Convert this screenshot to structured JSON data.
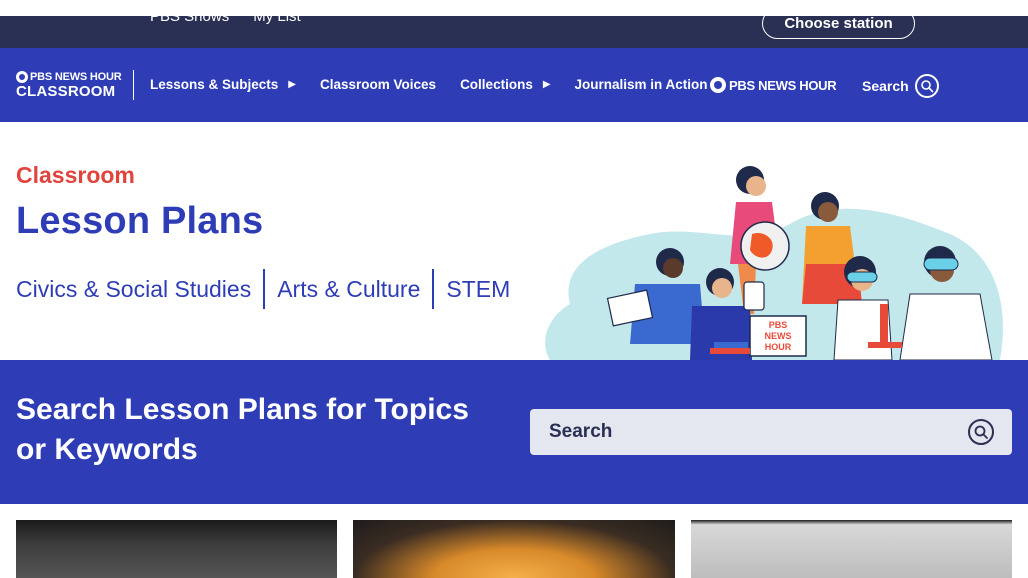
{
  "utility": {
    "links": [
      "PBS Shows",
      "My List"
    ],
    "station_button": "Choose station"
  },
  "nav": {
    "logo_line1": "PBS NEWS HOUR",
    "logo_line2": "CLASSROOM",
    "items": [
      {
        "label": "Lessons & Subjects",
        "has_caret": true
      },
      {
        "label": "Classroom Voices",
        "has_caret": false
      },
      {
        "label": "Collections",
        "has_caret": true
      },
      {
        "label": "Journalism in Action",
        "has_caret": false
      }
    ],
    "caret_glyph": "▶",
    "partner_logo": "PBS NEWS HOUR",
    "search_label": "Search"
  },
  "hero": {
    "eyebrow": "Classroom",
    "title": "Lesson Plans",
    "subjects": [
      "Civics & Social Studies",
      "Arts & Culture",
      "STEM"
    ],
    "sign_text": "PBS NEWS HOUR"
  },
  "search": {
    "heading": "Search Lesson Plans for Topics or Keywords",
    "placeholder": "Search"
  },
  "colors": {
    "brand_blue": "#2e3db6",
    "dark_navy": "#2a2f54",
    "accent_red": "#e0443d",
    "search_bg": "#e4e7ef"
  }
}
